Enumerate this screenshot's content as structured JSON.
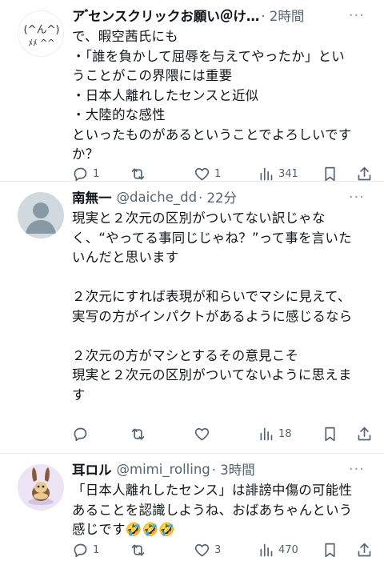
{
  "tweets": [
    {
      "author_name": "ア ゙センスクリックお願い＠け…",
      "author_handle": "",
      "time": "· 2時間",
      "avatar_text": "(^ん^)",
      "avatar_hands": "ﾒﾒ ^^",
      "body": "で、暇空茜氏にも\n・「誰を負かして屈辱を与えてやったか」とい\nうことがこの界隈には重要\n・日本人離れしたセンスと近似\n・大陸的な感性\nといったものがあるということでよろしいです\nか？",
      "replies": "1",
      "retweets": "",
      "likes": "1",
      "views": "341"
    },
    {
      "author_name": "南無一",
      "author_handle": "@daiche_dd",
      "time": "· 22分",
      "body": "現実と２次元の区別がついてない訳じゃな\nく、“やってる事同じじゃね？”って事を言いた\nいんだと思います\n\n２次元にすれば表現が和らいでマシに見えて、\n実写の方がインパクトがあるように感じるなら\n\n２次元の方がマシとするその意見こそ\n現実と２次元の区別がついてないように思えま\nす",
      "replies": "",
      "retweets": "",
      "likes": "",
      "views": "18"
    },
    {
      "author_name": "耳ロル",
      "author_handle": "@mimi_rolling",
      "time": "· 3時間",
      "body": "「日本人離れしたセンス」は誹謗中傷の可能性\nあることを認識しようね、おばあちゃんという\n感じです🤣🤣🤣",
      "replies": "1",
      "retweets": "",
      "likes": "3",
      "views": "470"
    }
  ],
  "more_glyph": "···",
  "colors": {
    "text": "#0f1419",
    "muted": "#536471",
    "divider": "#e6e9ec"
  },
  "icons": [
    "reply-icon",
    "retweet-icon",
    "like-icon",
    "views-icon",
    "bookmark-icon",
    "share-icon"
  ]
}
